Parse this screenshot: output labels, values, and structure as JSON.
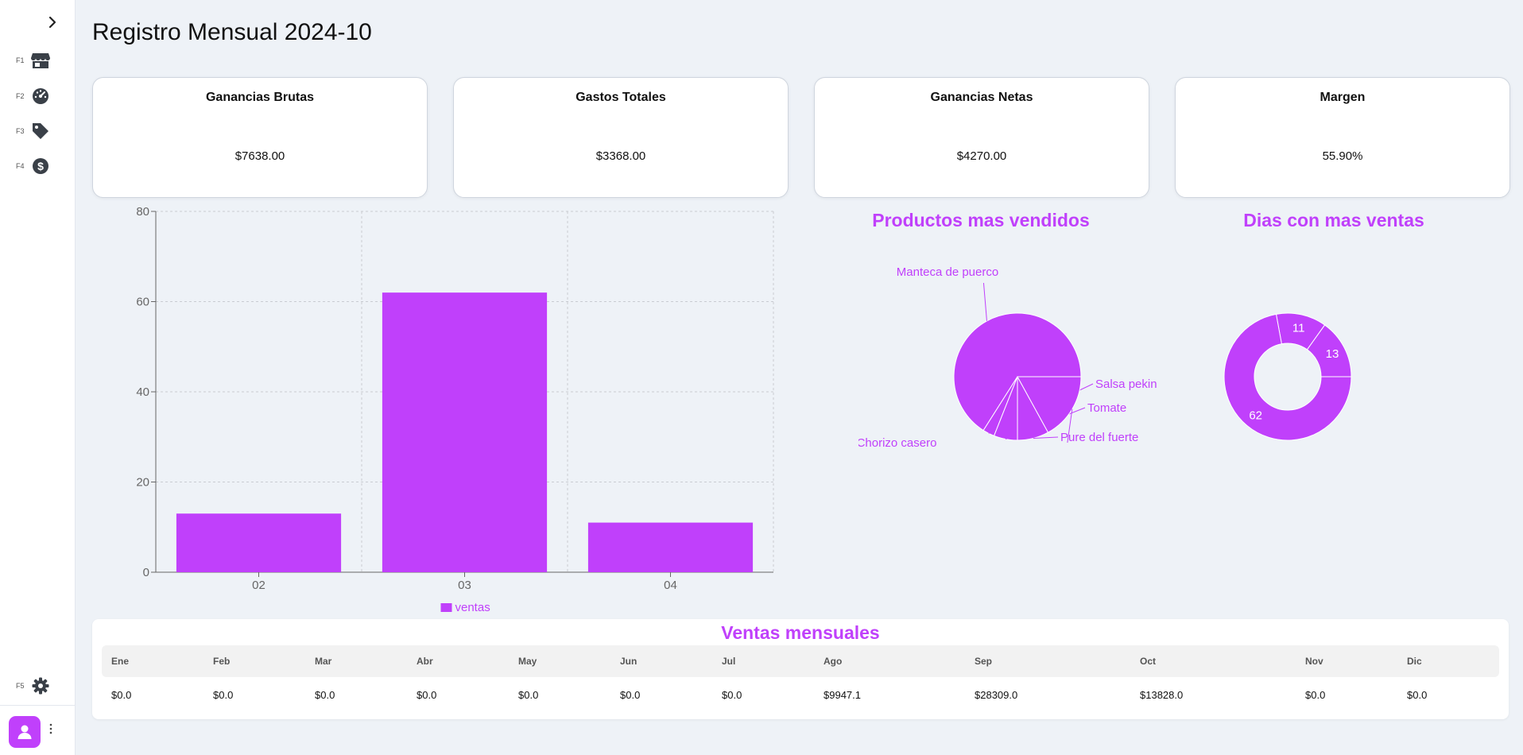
{
  "page": {
    "title": "Registro Mensual 2024-10"
  },
  "sidebar": {
    "toggle_icon": "chevron-right-icon",
    "items": [
      {
        "key": "F1",
        "icon": "store-icon"
      },
      {
        "key": "F2",
        "icon": "dashboard-gauge-icon"
      },
      {
        "key": "F3",
        "icon": "tag-icon"
      },
      {
        "key": "F4",
        "icon": "dollar-icon"
      }
    ],
    "settings": {
      "key": "F5",
      "icon": "gear-icon"
    },
    "user": {
      "icon": "user-icon",
      "menu_icon": "more-vertical-icon"
    }
  },
  "cards": [
    {
      "title": "Ganancias Brutas",
      "value": "$7638.00"
    },
    {
      "title": "Gastos Totales",
      "value": "$3368.00"
    },
    {
      "title": "Ganancias Netas",
      "value": "$4270.00"
    },
    {
      "title": "Margen",
      "value": "55.90%"
    }
  ],
  "colors": {
    "accent": "#c040fb",
    "background": "#eef2f7"
  },
  "chart_data": [
    {
      "type": "bar",
      "categories": [
        "02",
        "03",
        "04"
      ],
      "series": [
        {
          "name": "ventas",
          "values": [
            13,
            62,
            11
          ]
        }
      ],
      "ylim": [
        0,
        80
      ],
      "yticks": [
        0,
        20,
        40,
        60,
        80
      ],
      "grid": true,
      "legend": "bottom"
    },
    {
      "type": "pie",
      "title": "Productos mas vendidos",
      "labels": [
        "Manteca de puerco",
        "Salsa pekin",
        "Tomate",
        "Pure del fuerte",
        "Chorizo casero"
      ],
      "values": [
        66,
        3,
        6,
        8,
        17
      ]
    },
    {
      "type": "pie",
      "title": "Dias con mas ventas",
      "labels": [
        "13",
        "11",
        "62"
      ],
      "values": [
        13,
        11,
        62
      ]
    }
  ],
  "table": {
    "title": "Ventas mensuales",
    "headers": [
      "Ene",
      "Feb",
      "Mar",
      "Abr",
      "May",
      "Jun",
      "Jul",
      "Ago",
      "Sep",
      "Oct",
      "Nov",
      "Dic"
    ],
    "values": [
      "$0.0",
      "$0.0",
      "$0.0",
      "$0.0",
      "$0.0",
      "$0.0",
      "$0.0",
      "$9947.1",
      "$28309.0",
      "$13828.0",
      "$0.0",
      "$0.0"
    ]
  }
}
